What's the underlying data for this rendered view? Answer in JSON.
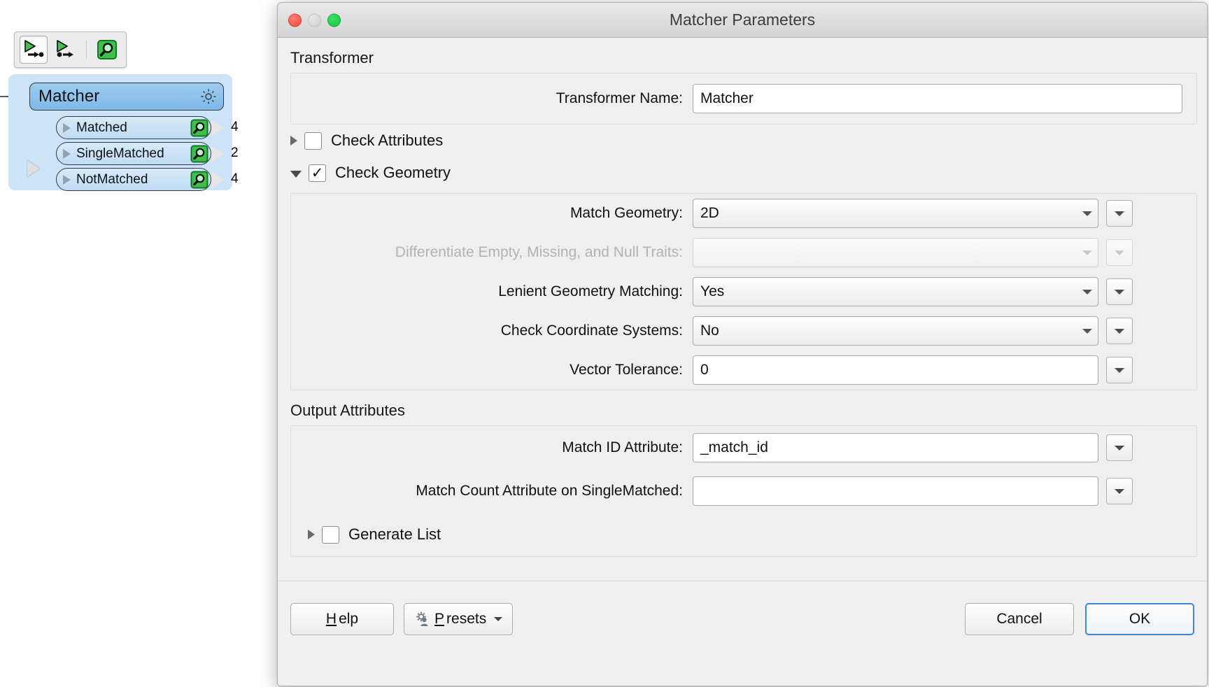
{
  "canvas": {
    "toolbar": {
      "buttons": [
        {
          "name": "run-to-this-icon",
          "state": "pressed"
        },
        {
          "name": "run-from-this-icon",
          "state": "normal"
        },
        {
          "name": "inspect-magnifier-icon",
          "state": "normal"
        }
      ]
    },
    "node": {
      "title": "Matcher",
      "gear_icon": "gear-icon",
      "ports": [
        {
          "label": "Matched",
          "count": "4"
        },
        {
          "label": "SingleMatched",
          "count": "2"
        },
        {
          "label": "NotMatched",
          "count": "4"
        }
      ]
    }
  },
  "dialog": {
    "title": "Matcher Parameters",
    "window_controls": {
      "close": "close-light",
      "minimize": "minimize-light",
      "maximize": "maximize-light"
    },
    "sections": {
      "transformer": {
        "heading": "Transformer",
        "name_label": "Transformer Name:",
        "name_value": "Matcher"
      },
      "check_attributes": {
        "label": "Check Attributes",
        "checked": false,
        "expanded": false
      },
      "check_geometry": {
        "label": "Check Geometry",
        "checked": true,
        "checkmark": "✓",
        "expanded": true,
        "fields": [
          {
            "label": "Match Geometry:",
            "value": "2D",
            "type": "combo",
            "disabled": false
          },
          {
            "label": "Differentiate Empty, Missing, and Null Traits:",
            "value": "",
            "type": "combo",
            "disabled": true
          },
          {
            "label": "Lenient Geometry Matching:",
            "value": "Yes",
            "type": "combo",
            "disabled": false
          },
          {
            "label": "Check Coordinate Systems:",
            "value": "No",
            "type": "combo",
            "disabled": false
          },
          {
            "label": "Vector Tolerance:",
            "value": "0",
            "type": "text",
            "disabled": false
          }
        ]
      },
      "output_attributes": {
        "heading": "Output Attributes",
        "fields": [
          {
            "label": "Match ID Attribute:",
            "value": "_match_id",
            "type": "text"
          },
          {
            "label": "Match Count Attribute on SingleMatched:",
            "value": "",
            "type": "text"
          }
        ],
        "generate_list": {
          "label": "Generate List",
          "checked": false,
          "expanded": false
        }
      }
    },
    "footer": {
      "help": "Help",
      "help_mnemonic": "H",
      "presets": "Presets",
      "presets_mnemonic": "P",
      "cancel": "Cancel",
      "ok": "OK"
    }
  },
  "colors": {
    "node_header_fill": "#8fc2ec",
    "node_body_fill": "#cde3f7",
    "node_border": "#2f3b44",
    "green_icon": "#3ec04a",
    "ok_border": "#3e86dd",
    "dialog_bg": "#f0f0f0",
    "disabled_text": "#b3b3b3"
  }
}
